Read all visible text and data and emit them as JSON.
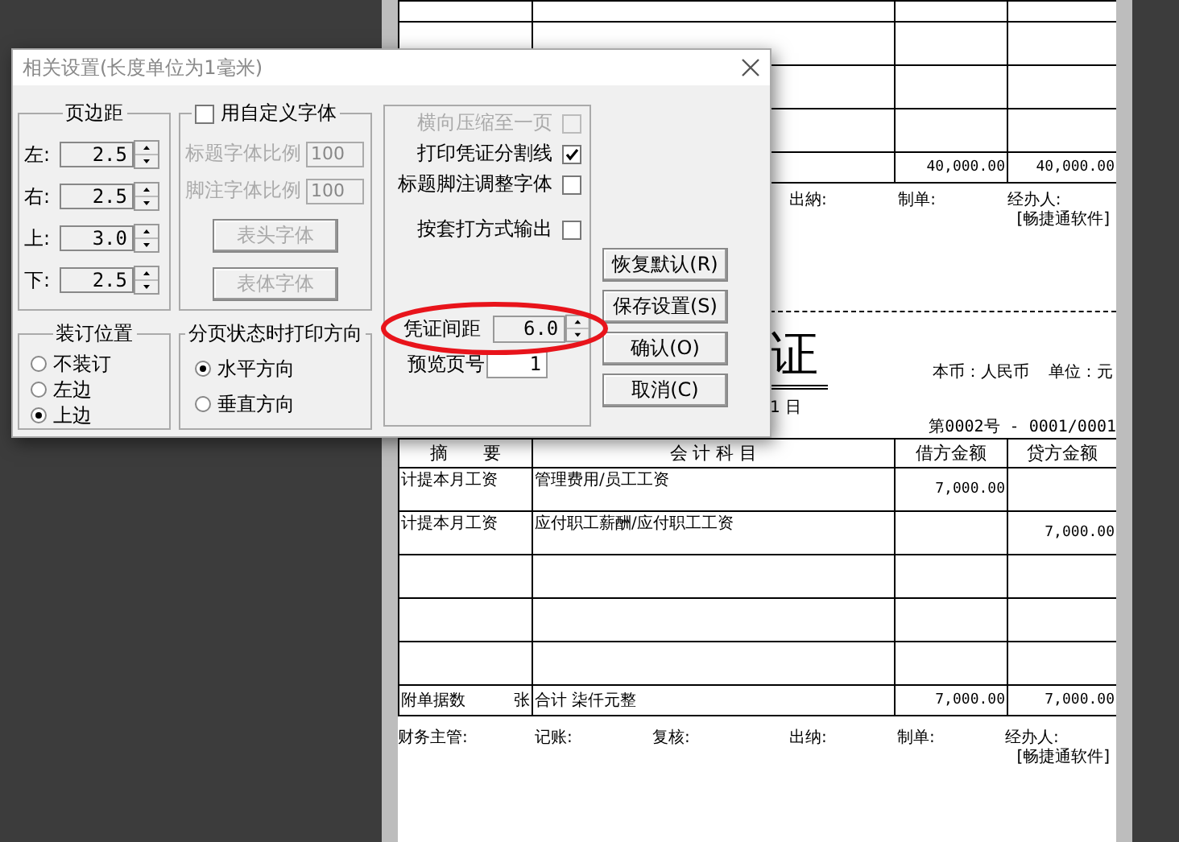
{
  "dialog": {
    "title": "相关设置(长度单位为1毫米)",
    "margins": {
      "title": "页边距",
      "fields": [
        {
          "label": "左:",
          "value": "2.5"
        },
        {
          "label": "右:",
          "value": "2.5"
        },
        {
          "label": "上:",
          "value": "3.0"
        },
        {
          "label": "下:",
          "value": "2.5"
        }
      ]
    },
    "custom_font": {
      "label": "用自定义字体",
      "checked": false,
      "fields": [
        {
          "label": "标题字体比例",
          "value": "100"
        },
        {
          "label": "脚注字体比例",
          "value": "100"
        }
      ],
      "buttons": [
        "表头字体",
        "表体字体"
      ]
    },
    "binding": {
      "title": "装订位置",
      "options": [
        {
          "label": "不装订",
          "selected": false
        },
        {
          "label": "左边",
          "selected": false
        },
        {
          "label": "上边",
          "selected": true
        }
      ]
    },
    "direction": {
      "title": "分页状态时打印方向",
      "options": [
        {
          "label": "水平方向",
          "selected": true
        },
        {
          "label": "垂直方向",
          "selected": false
        }
      ]
    },
    "options": [
      {
        "label": "横向压缩至一页",
        "checked": false,
        "disabled": true
      },
      {
        "label": "打印凭证分割线",
        "checked": true,
        "disabled": false
      },
      {
        "label": "标题脚注调整字体",
        "checked": false,
        "disabled": false
      },
      {
        "label": "按套打方式输出",
        "checked": false,
        "disabled": false
      }
    ],
    "spacing": {
      "label": "凭证间距",
      "value": "6.0"
    },
    "preview_page": {
      "label": "预览页号",
      "value": "1"
    },
    "buttons": [
      "恢复默认(R)",
      "保存设置(S)",
      "确认(O)",
      "取消(C)"
    ]
  },
  "voucher_top": {
    "total": {
      "debit": "40,000.00",
      "credit": "40,000.00"
    },
    "signatures": [
      "出納:",
      "制单:",
      "经办人:"
    ],
    "software": "[畅捷通软件]"
  },
  "voucher": {
    "title": "证",
    "date": "1 日",
    "currency": "本币：人民币",
    "unit": "单位：元",
    "number": "第0002号 - 0001/0001",
    "columns": [
      "摘　　要",
      "会 计 科 目",
      "借方金额",
      "贷方金额"
    ],
    "rows": [
      {
        "summary": "计提本月工资",
        "account": "管理费用/员工工资",
        "debit": "7,000.00"
      },
      {
        "summary": "计提本月工资",
        "account": "应付职工薪酬/应付职工工资",
        "credit": "7,000.00"
      }
    ],
    "total": {
      "attachments": "附单据数",
      "unit": "张",
      "amount_text": "合计 柒仟元整",
      "debit": "7,000.00",
      "credit": "7,000.00"
    },
    "signatures": [
      "财务主管:",
      "记账:",
      "复核:",
      "出纳:",
      "制单:",
      "经办人:"
    ],
    "software": "[畅捷通软件]"
  }
}
